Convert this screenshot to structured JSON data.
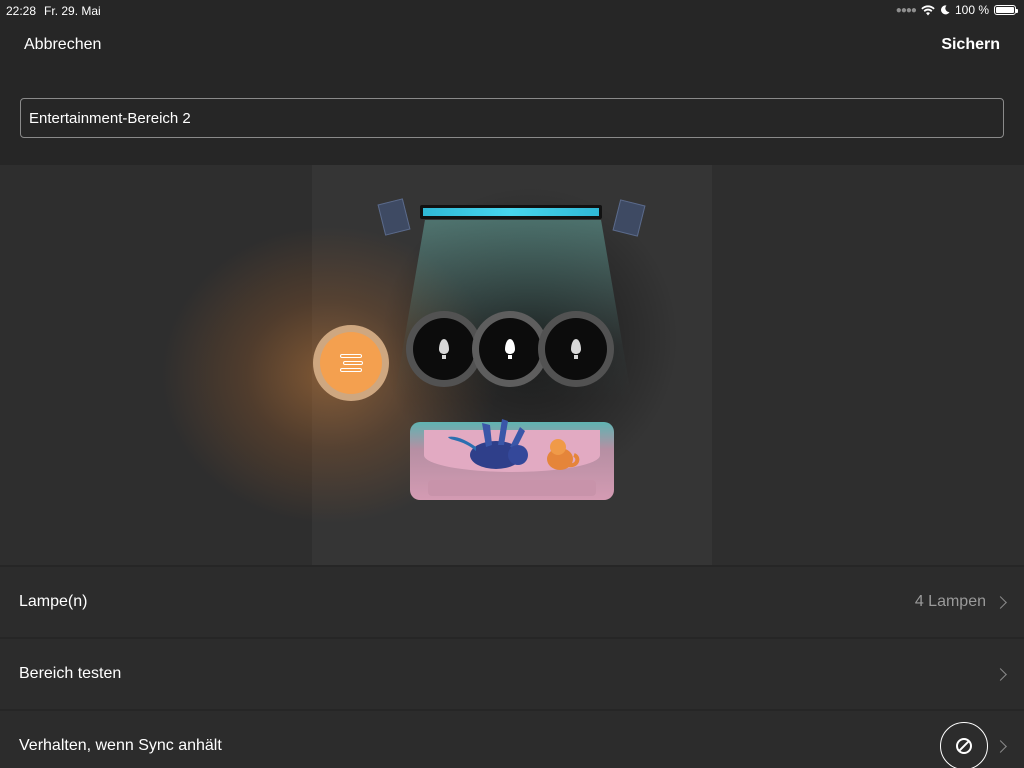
{
  "status_bar": {
    "time": "22:28",
    "date": "Fr. 29. Mai",
    "battery": "100 %",
    "battery_level": 1.0
  },
  "nav": {
    "cancel_label": "Abbrechen",
    "save_label": "Sichern"
  },
  "area_name": {
    "value": "Entertainment-Bereich 2"
  },
  "room_preview": {
    "tv_color": "#47d6ee",
    "active_lamp_color": "#f4a04f",
    "lamps": [
      {
        "type": "lightstrip-icon",
        "state": "on"
      },
      {
        "type": "bulb-icon",
        "state": "off"
      },
      {
        "type": "bulb-icon",
        "state": "off"
      },
      {
        "type": "bulb-icon",
        "state": "off"
      }
    ]
  },
  "settings": {
    "lamps_label": "Lampe(n)",
    "lamps_value": "4 Lampen",
    "test_label": "Bereich testen",
    "sync_label": "Verhalten, wenn Sync anhält",
    "sync_icon": "prohibited-icon"
  }
}
